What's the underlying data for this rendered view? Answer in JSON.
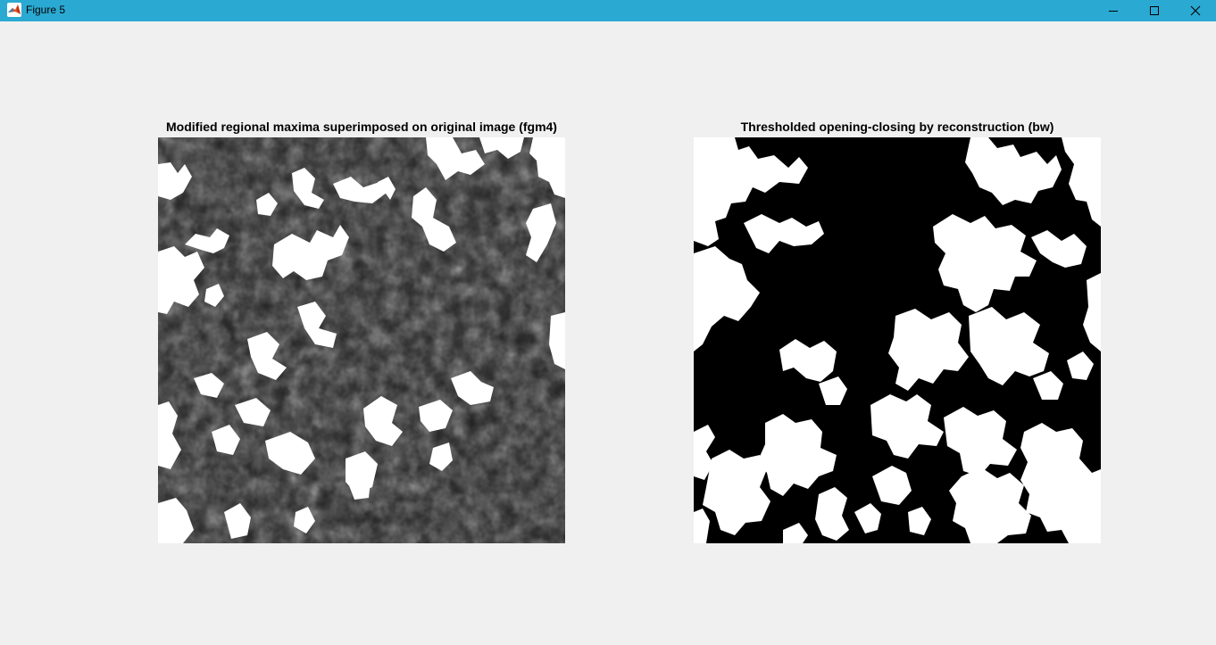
{
  "window": {
    "title": "Figure 5",
    "app_icon": "matlab-icon",
    "controls": {
      "minimize_icon": "minimize-icon",
      "maximize_icon": "maximize-icon",
      "close_icon": "close-icon"
    },
    "titlebar_color": "#2aa9d2"
  },
  "figure": {
    "background": "#f0f0f0",
    "axes": [
      {
        "title": "Modified regional maxima superimposed on original image (fgm4)",
        "content": "grayscale-image-with-white-overlay"
      },
      {
        "title": "Thresholded opening-closing by reconstruction (bw)",
        "content": "binary-image"
      }
    ]
  }
}
